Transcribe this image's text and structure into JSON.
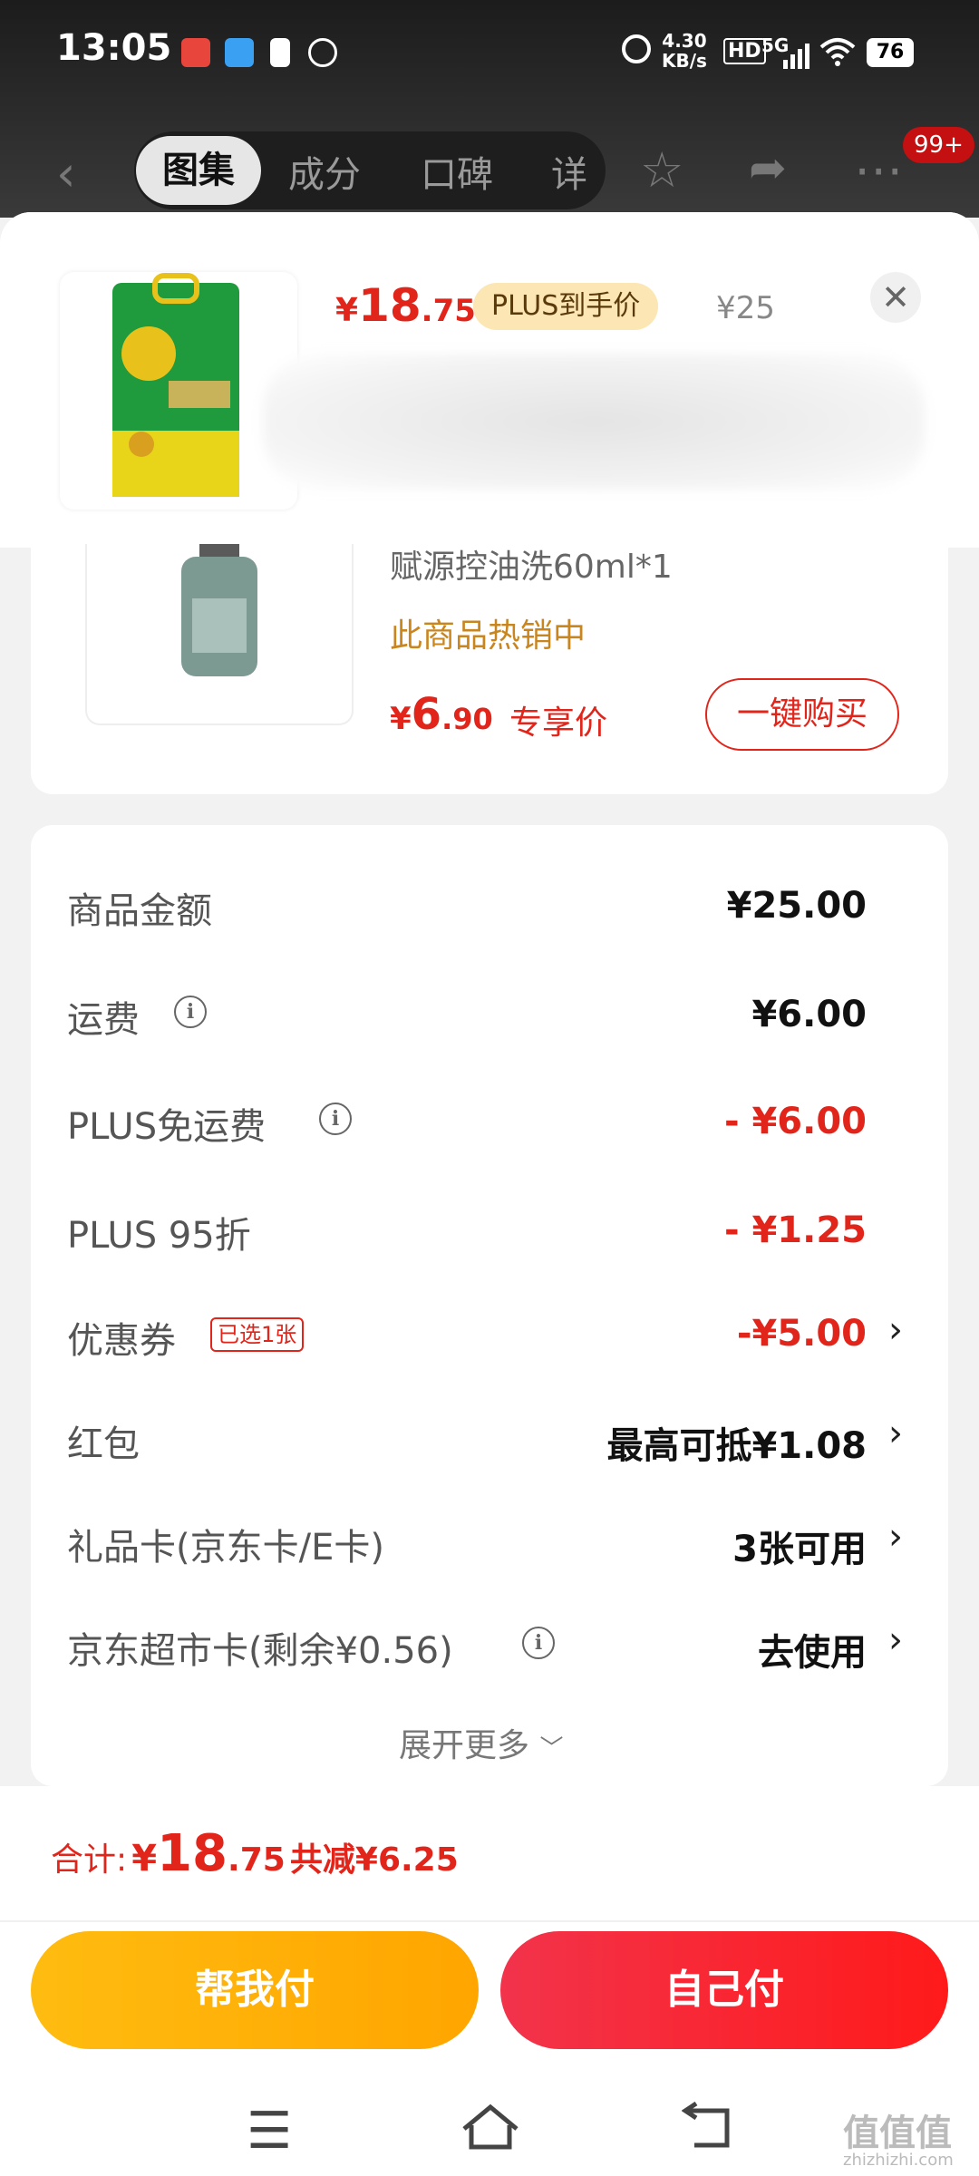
{
  "status_bar": {
    "time": "13:05",
    "net_speed_value": "4.30",
    "net_speed_unit": "KB/s",
    "hd": "HD",
    "network": "5G",
    "battery": "76"
  },
  "nav": {
    "tabs": [
      "图集",
      "成分",
      "口碑",
      "详"
    ],
    "active_tab": "图集",
    "badge": "99+"
  },
  "product": {
    "price_symbol": "¥",
    "price_int": "18",
    "price_dec": ".75",
    "plus_tag": "PLUS到手价",
    "original_price": "¥25"
  },
  "related": {
    "title": "赋源控油洗60ml*1",
    "hot_text": "此商品热销中",
    "price_symbol": "¥",
    "price_int": "6",
    "price_dec": ".90",
    "exclusive": "专享价",
    "buy_button": "一键购买"
  },
  "summary": {
    "rows": [
      {
        "label": "商品金额",
        "value": "¥25.00"
      },
      {
        "label": "运费",
        "value": "¥6.00"
      },
      {
        "label": "PLUS免运费",
        "value": "- ¥6.00"
      },
      {
        "label": "PLUS 95折",
        "value": "- ¥1.25"
      },
      {
        "label": "优惠券",
        "value": "-¥5.00",
        "badge": "已选1张"
      },
      {
        "label": "红包",
        "value": "最高可抵¥1.08"
      },
      {
        "label": "礼品卡(京东卡/E卡)",
        "value": "3张可用"
      },
      {
        "label": "京东超市卡(剩余¥0.56)",
        "value": "去使用"
      }
    ],
    "expand": "展开更多"
  },
  "footer": {
    "total_label": "合计:",
    "total_symbol": "¥",
    "total_int": "18",
    "total_dec": ".75",
    "saved": "共减¥6.25",
    "help_pay": "帮我付",
    "self_pay": "自己付"
  },
  "watermark": {
    "text": "值值值",
    "domain": "zhizhizhi.com"
  },
  "colors": {
    "accent_red": "#e1251b",
    "plus_gold": "#fbe6b4",
    "help_orange": "#ffb00f",
    "self_red": "#f52a35"
  }
}
